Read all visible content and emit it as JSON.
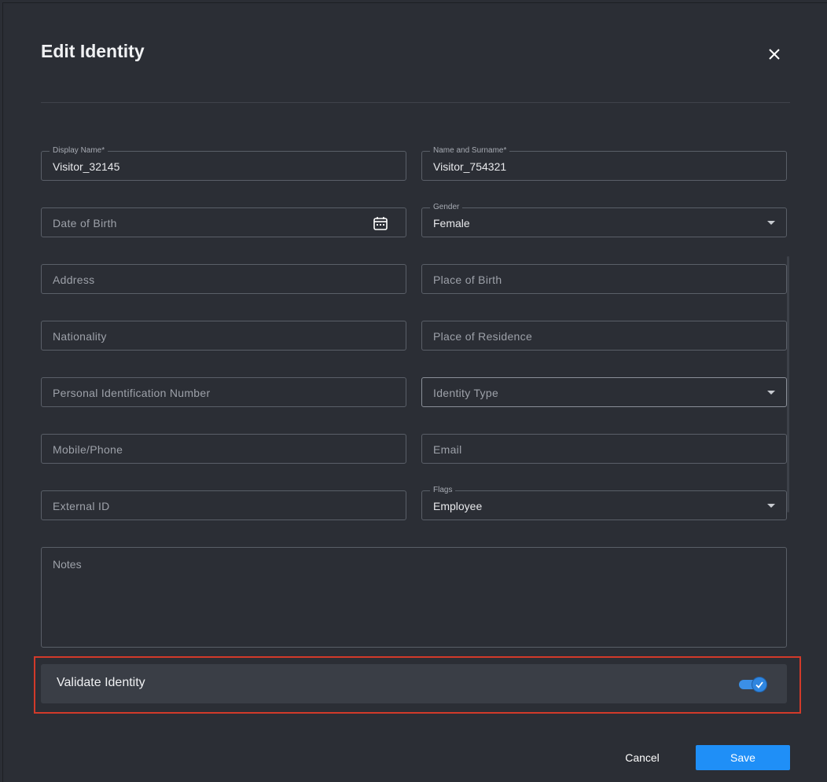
{
  "dialog": {
    "title": "Edit Identity",
    "close_icon": "close-icon"
  },
  "fields": {
    "display_name": {
      "label": "Display Name*",
      "value": "Visitor_32145"
    },
    "name_surname": {
      "label": "Name and Surname*",
      "value": "Visitor_754321"
    },
    "date_of_birth": {
      "placeholder": "Date of Birth",
      "icon": "calendar-icon"
    },
    "gender": {
      "label": "Gender",
      "value": "Female"
    },
    "address": {
      "placeholder": "Address"
    },
    "place_of_birth": {
      "placeholder": "Place of Birth"
    },
    "nationality": {
      "placeholder": "Nationality"
    },
    "place_of_residence": {
      "placeholder": "Place of Residence"
    },
    "pin": {
      "placeholder": "Personal Identification Number"
    },
    "identity_type": {
      "placeholder": "Identity Type"
    },
    "mobile": {
      "placeholder": "Mobile/Phone"
    },
    "email": {
      "placeholder": "Email"
    },
    "external_id": {
      "placeholder": "External ID"
    },
    "flags": {
      "label": "Flags",
      "value": "Employee"
    },
    "notes": {
      "placeholder": "Notes"
    }
  },
  "validate": {
    "label": "Validate Identity",
    "enabled": true,
    "accent": "#2f86e0"
  },
  "footer": {
    "cancel_label": "Cancel",
    "save_label": "Save"
  },
  "colors": {
    "background": "#2b2e35",
    "primary": "#1f8ff7",
    "highlight": "#d23a2a"
  }
}
